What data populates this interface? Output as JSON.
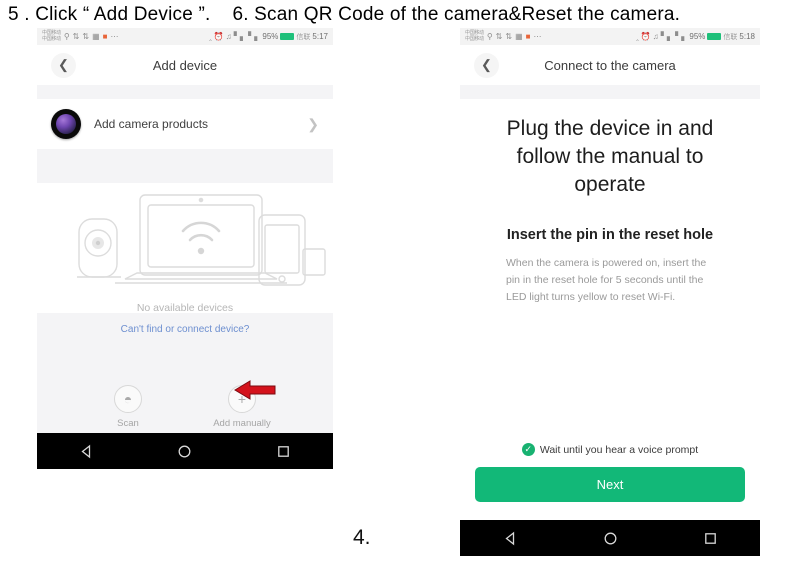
{
  "captions": {
    "step5": "5 . Click “ Add Device ”.",
    "step6": "6. Scan QR Code of the camera&Reset the camera."
  },
  "step_marker": "4.",
  "colors": {
    "accent_green": "#12b878",
    "link_blue": "#6d8fd0",
    "arrow_red": "#d4121c",
    "battery_green": "#1ec07a"
  },
  "phone_left": {
    "statusbar": {
      "carrier_line1": "中国移动",
      "carrier_line2": "中国移动",
      "search_icon": "search-icon",
      "upload_icon": "upload-icon",
      "download_icon": "download-icon",
      "sim_icon": "sim-icon",
      "app_icon": "app-icon",
      "more_icon": "more-icon",
      "bluetooth_icon": "bluetooth-icon",
      "alarm_icon": "alarm-icon",
      "mute_icon": "mute-icon",
      "signal_icon": "signal-bars-icon",
      "battery_percent": "95%",
      "battery_icon": "battery-icon",
      "network_label": "信联",
      "time": "5:17"
    },
    "titlebar": {
      "back_icon": "chevron-left-icon",
      "title": "Add device"
    },
    "camera_row": {
      "lens_icon": "camera-lens-icon",
      "label": "Add camera products",
      "chevron": "chevron-right-icon"
    },
    "illustration": {
      "name": "devices-wifi-illustration",
      "caption": "No available devices"
    },
    "help_link": "Can't find or connect device?",
    "actions": [
      {
        "icon": "scan-icon",
        "glyph": "◔",
        "label": "Scan"
      },
      {
        "icon": "plus-icon",
        "glyph": "+",
        "label": "Add manually"
      }
    ],
    "arrow_annotation": "red-left-arrow",
    "navbar": {
      "back": "nav-back-triangle-icon",
      "home": "nav-home-circle-icon",
      "recents": "nav-recents-square-icon"
    }
  },
  "phone_right": {
    "statusbar": {
      "carrier_line1": "中国移动",
      "carrier_line2": "中国移动",
      "battery_percent": "95%",
      "network_label": "信联",
      "time": "5:18"
    },
    "titlebar": {
      "back_icon": "chevron-left-icon",
      "title": "Connect to the camera"
    },
    "hero": "Plug the device in and follow the manual to operate",
    "subheading": "Insert the pin in the reset hole",
    "body": "When the camera is powered on, insert the pin in the reset hole for 5 seconds until the LED light turns yellow to reset Wi-Fi.",
    "confirm": {
      "check_icon": "check-circle-icon",
      "text": "Wait until you hear a voice prompt"
    },
    "next_button": "Next",
    "navbar": {
      "back": "nav-back-triangle-icon",
      "home": "nav-home-circle-icon",
      "recents": "nav-recents-square-icon"
    }
  }
}
